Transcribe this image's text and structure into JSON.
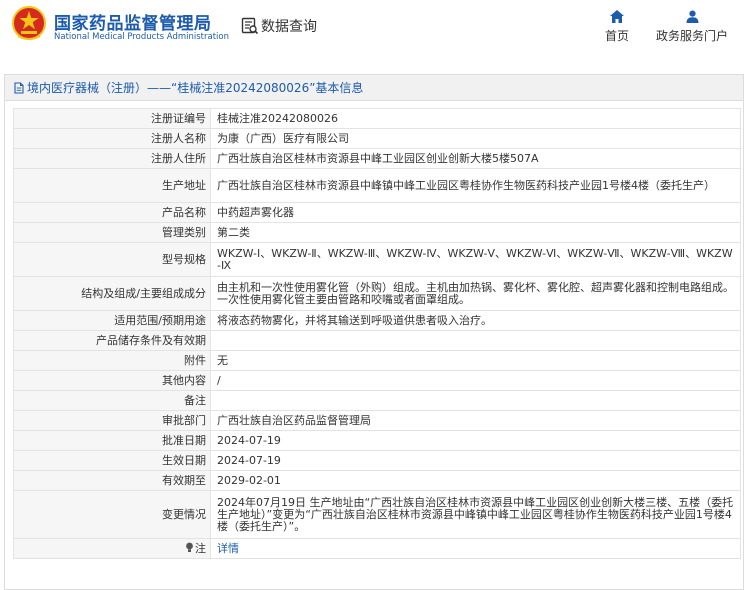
{
  "header": {
    "title_cn": "国家药品监督管理局",
    "title_en": "National Medical Products Administration",
    "query_label": "数据查询",
    "nav": [
      {
        "label": "首页",
        "icon": "home-icon"
      },
      {
        "label": "政务服务门户",
        "icon": "user-icon"
      }
    ]
  },
  "panel": {
    "title": "境内医疗器械（注册）——“桂械注准20242080026”基本信息"
  },
  "rows": [
    {
      "label": "注册证编号",
      "value": "桂械注准20242080026"
    },
    {
      "label": "注册人名称",
      "value": "为康（广西）医疗有限公司"
    },
    {
      "label": "注册人住所",
      "value": "广西壮族自治区桂林市资源县中峰工业园区创业创新大楼5楼507A"
    },
    {
      "label": "生产地址",
      "value": "广西壮族自治区桂林市资源县中峰镇中峰工业园区粤桂协作生物医药科技产业园1号楼4楼（委托生产）"
    },
    {
      "label": "产品名称",
      "value": "中药超声雾化器"
    },
    {
      "label": "管理类别",
      "value": "第二类"
    },
    {
      "label": "型号规格",
      "value": "WKZW-Ⅰ、WKZW-Ⅱ、WKZW-Ⅲ、WKZW-Ⅳ、WKZW-Ⅴ、WKZW-Ⅵ、WKZW-Ⅶ、WKZW-Ⅷ、WKZW-Ⅸ"
    },
    {
      "label": "结构及组成/主要组成成分",
      "value": "由主机和一次性使用雾化管（外购）组成。主机由加热锅、雾化杯、雾化腔、超声雾化器和控制电路组成。一次性使用雾化管主要由管路和咬嘴或者面罩组成。"
    },
    {
      "label": "适用范围/预期用途",
      "value": "将液态药物雾化，并将其输送到呼吸道供患者吸入治疗。"
    },
    {
      "label": "产品储存条件及有效期",
      "value": ""
    },
    {
      "label": "附件",
      "value": "无"
    },
    {
      "label": "其他内容",
      "value": "/"
    },
    {
      "label": "备注",
      "value": ""
    },
    {
      "label": "审批部门",
      "value": "广西壮族自治区药品监督管理局"
    },
    {
      "label": "批准日期",
      "value": "2024-07-19"
    },
    {
      "label": "生效日期",
      "value": "2024-07-19"
    },
    {
      "label": "有效期至",
      "value": "2029-02-01"
    },
    {
      "label": "变更情况",
      "value": "2024年07月19日 生产地址由“广西壮族自治区桂林市资源县中峰工业园区创业创新大楼三楼、五楼（委托生产地址）”变更为“广西壮族自治区桂林市资源县中峰镇中峰工业园区粤桂协作生物医药科技产业园1号楼4楼（委托生产）”。"
    }
  ],
  "note_row": {
    "label": "注",
    "link": "详情"
  },
  "colors": {
    "brand_blue": "#1d5cac",
    "label_bg": "#f6f6f6",
    "emblem_red": "#d52b1e",
    "emblem_gold": "#f5c518"
  }
}
